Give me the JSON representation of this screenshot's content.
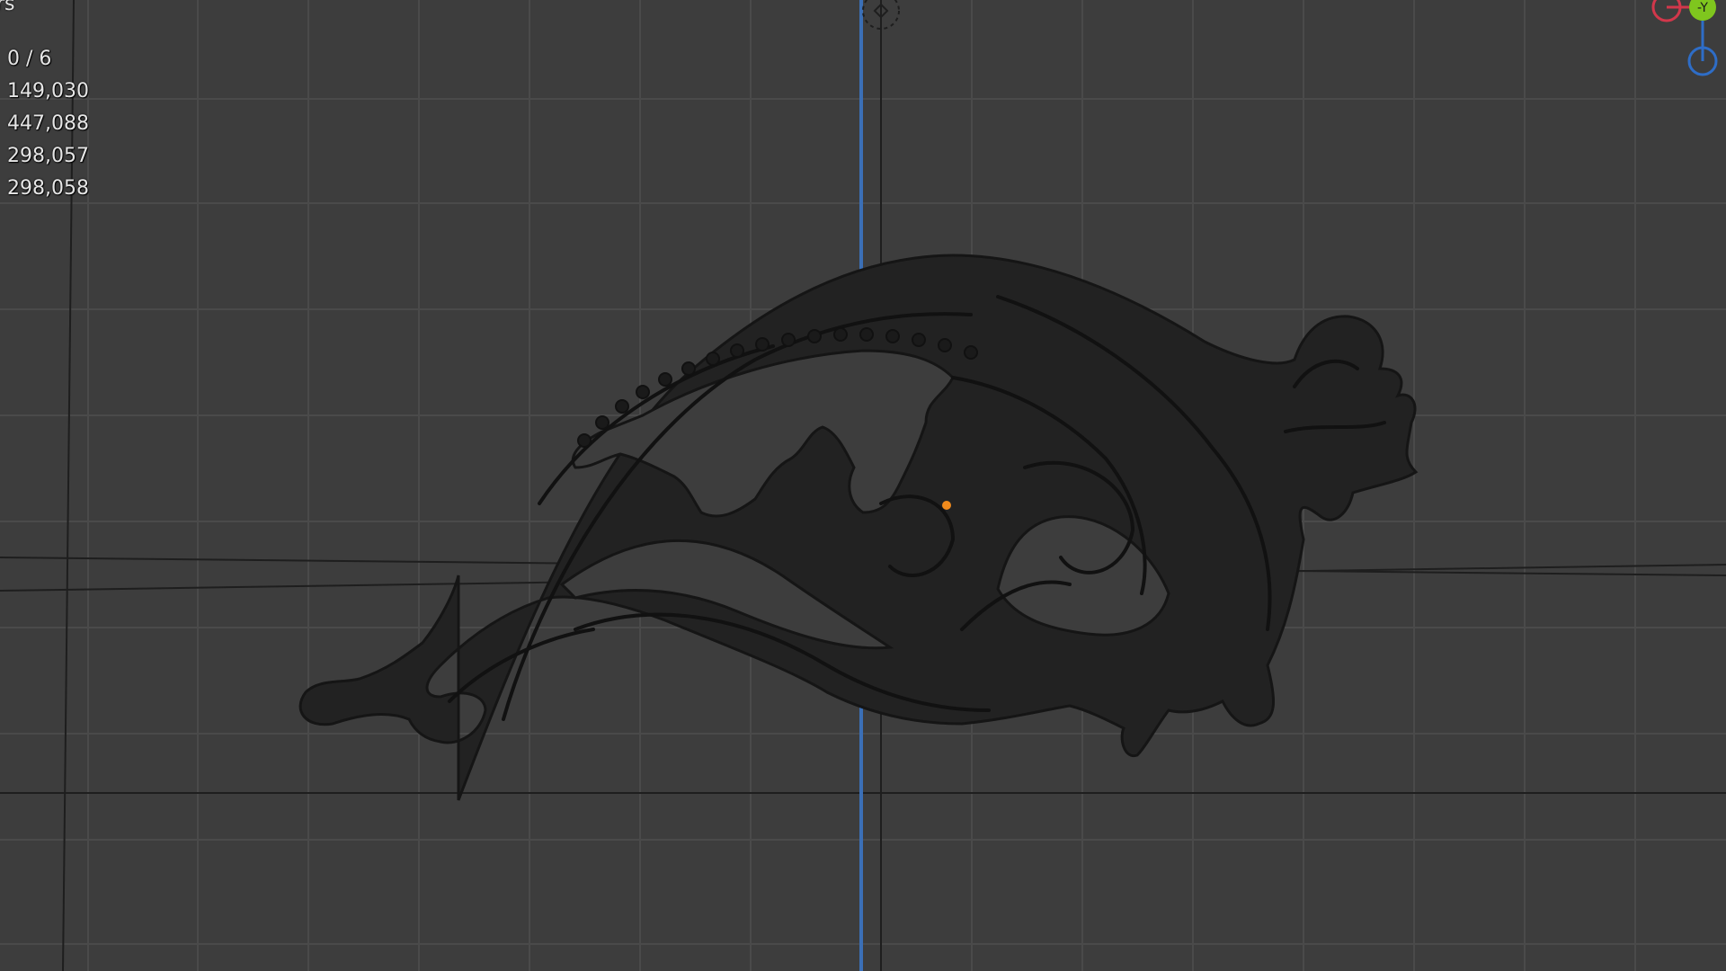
{
  "viewport": {
    "corner_label": "rs",
    "stats": [
      "0 / 6",
      "149,030",
      "447,088",
      "298,057",
      "298,058"
    ]
  },
  "gizmo": {
    "y_axis_label": "-Y"
  },
  "colors": {
    "background": "#3d3d3d",
    "grid_line": "#4a4a4a",
    "grid_major": "#1e1e1e",
    "z_axis": "#3b6fb6",
    "model": "#222222",
    "origin_dot": "#f08a1c",
    "gizmo_x": "#d2374b",
    "gizmo_y": "#7fc61e",
    "gizmo_z": "#2e6dc7"
  },
  "icons": {
    "light_gizmo": "light-gizmo-icon",
    "origin": "object-origin-icon"
  }
}
